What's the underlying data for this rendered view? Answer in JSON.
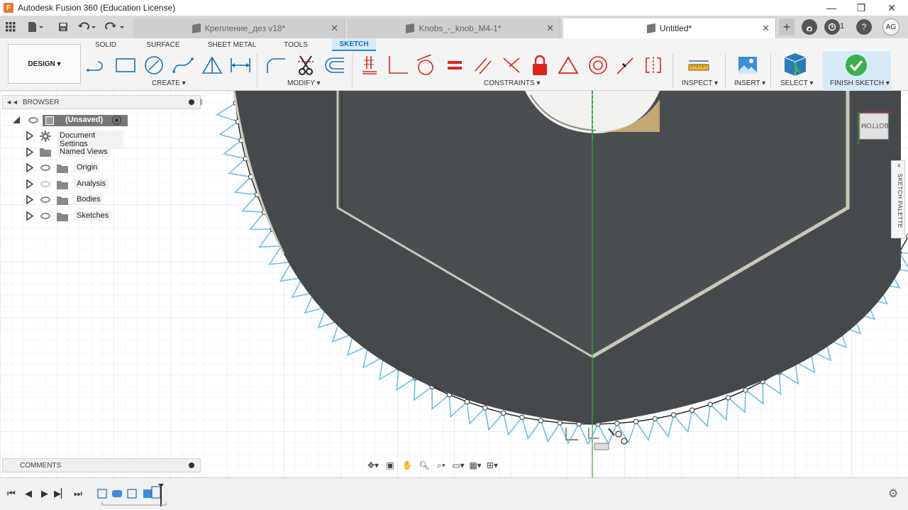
{
  "window": {
    "title": "Autodesk Fusion 360 (Education License)",
    "logo_letter": "F",
    "minimize": "—",
    "maximize": "❐",
    "close": "✕"
  },
  "tabs": [
    {
      "label": "Крепление_дез v18*",
      "close": "✕"
    },
    {
      "label": "Knobs_-_knob_M4-1*",
      "close": "✕"
    },
    {
      "label": "Untitled*",
      "close": "✕"
    }
  ],
  "tabbar": {
    "job_count": "1",
    "avatar_initials": "AG"
  },
  "ribbon": {
    "workspace": "DESIGN ▾",
    "tabs": [
      "SOLID",
      "SURFACE",
      "SHEET METAL",
      "TOOLS",
      "SKETCH"
    ],
    "active_tab": "SKETCH",
    "groups": {
      "create": "CREATE ▾",
      "modify": "MODIFY ▾",
      "constraints": "CONSTRAINTS ▾",
      "inspect": "INSPECT ▾",
      "insert": "INSERT ▾",
      "select": "SELECT ▾",
      "finish": "FINISH SKETCH ▾"
    },
    "colors": {
      "accent": "#1a8be0",
      "constraint_red": "#d9261c",
      "finish_green": "#3bb14a"
    }
  },
  "browser": {
    "title": "BROWSER",
    "root": "(Unsaved)",
    "items": [
      {
        "label": "Document Settings",
        "icon": "gear-icon",
        "visibility": "none"
      },
      {
        "label": "Named Views",
        "icon": "folder-icon",
        "visibility": "none"
      },
      {
        "label": "Origin",
        "icon": "folder-icon",
        "visibility": "visible"
      },
      {
        "label": "Analysis",
        "icon": "folder-icon",
        "visibility": "hidden"
      },
      {
        "label": "Bodies",
        "icon": "folder-icon",
        "visibility": "visible"
      },
      {
        "label": "Sketches",
        "icon": "folder-icon",
        "visibility": "visible"
      }
    ]
  },
  "comments": {
    "title": "COMMENTS"
  },
  "viewcube": {
    "face_label": "BOTTOM"
  },
  "sketch_palette": {
    "label": "SKETCH PALETTE"
  }
}
